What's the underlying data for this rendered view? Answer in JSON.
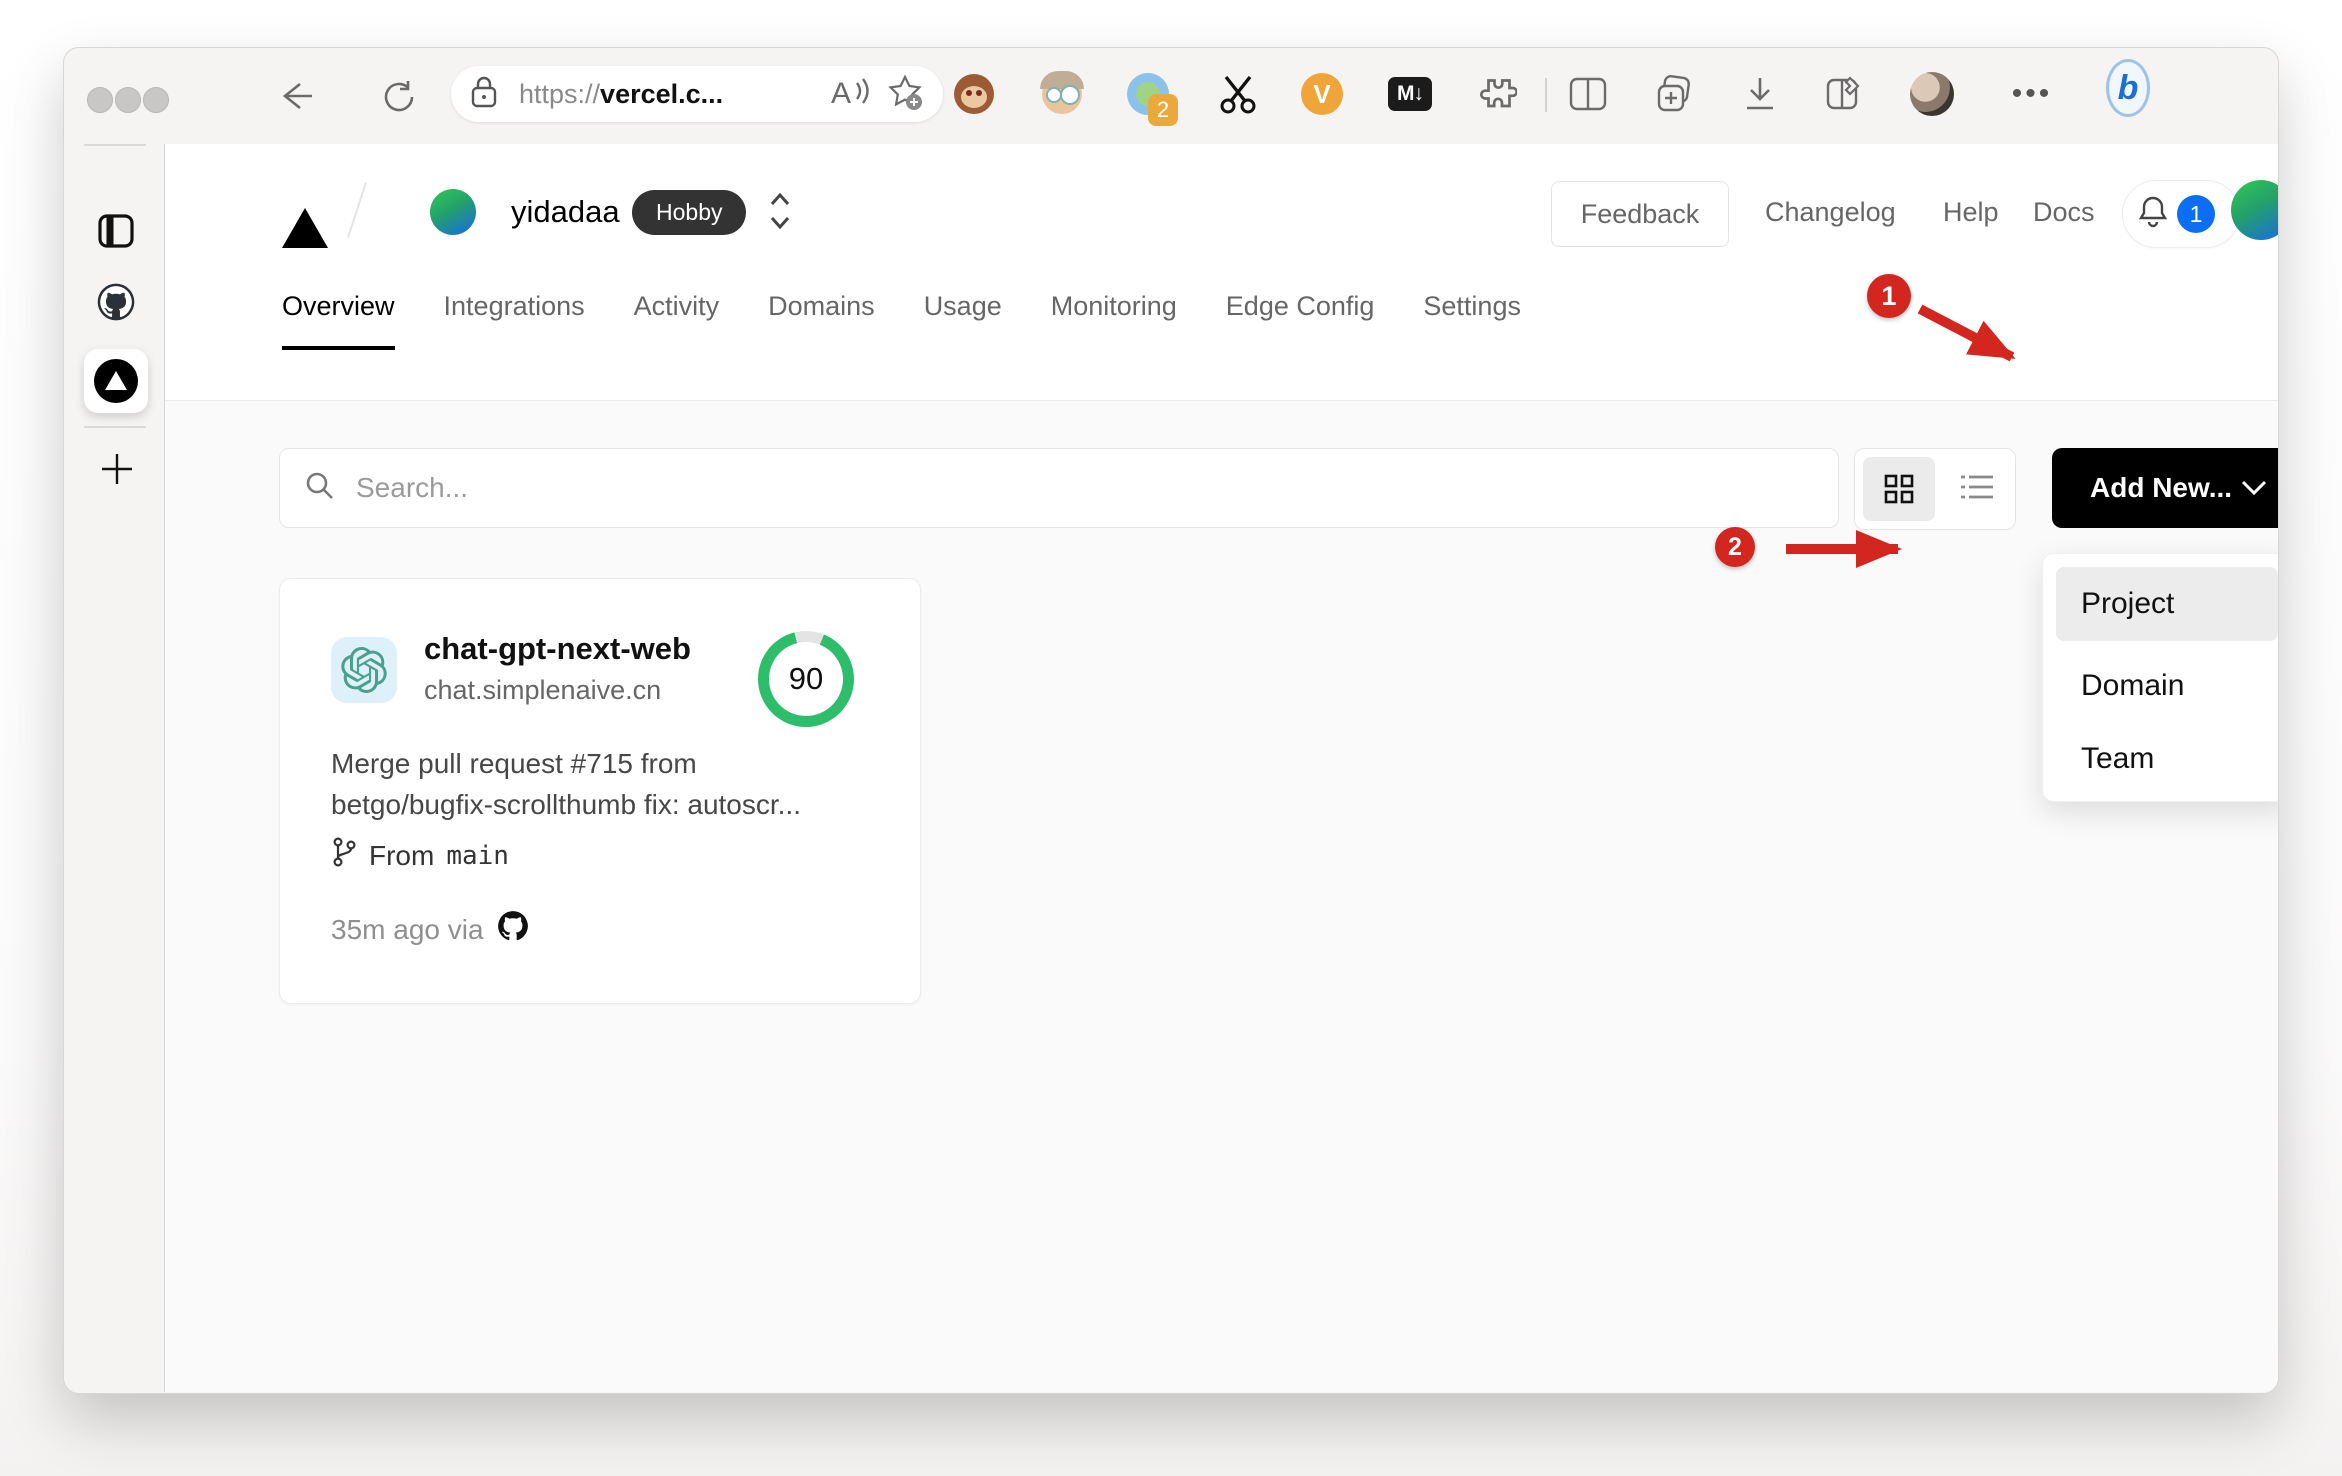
{
  "browser": {
    "url_scheme": "https://",
    "url_host": "vercel.c...",
    "extension_badge": "2",
    "v_ext_label": "V",
    "markdown_ext_label": "M↓",
    "bing_label": "b"
  },
  "vercel": {
    "team_name": "yidadaa",
    "plan_badge": "Hobby",
    "nav": {
      "feedback": "Feedback",
      "changelog": "Changelog",
      "help": "Help",
      "docs": "Docs"
    },
    "notification_count": "1",
    "tabs": [
      {
        "label": "Overview",
        "active": true
      },
      {
        "label": "Integrations",
        "active": false
      },
      {
        "label": "Activity",
        "active": false
      },
      {
        "label": "Domains",
        "active": false
      },
      {
        "label": "Usage",
        "active": false
      },
      {
        "label": "Monitoring",
        "active": false
      },
      {
        "label": "Edge Config",
        "active": false
      },
      {
        "label": "Settings",
        "active": false
      }
    ],
    "search_placeholder": "Search...",
    "add_new_label": "Add New...",
    "project_card": {
      "name": "chat-gpt-next-web",
      "domain": "chat.simplenaive.cn",
      "score": "90",
      "commit_line1": "Merge pull request #715 from",
      "commit_line2": "betgo/bugfix-scrollthumb fix: autoscr...",
      "branch_prefix": "From",
      "branch_name": "main",
      "deploy_meta": "35m ago via"
    },
    "add_new_menu": {
      "items": [
        {
          "label": "Project",
          "selected": true
        },
        {
          "label": "Domain",
          "selected": false
        },
        {
          "label": "Team",
          "selected": false
        }
      ]
    }
  },
  "annotations": {
    "step1": "1",
    "step2": "2"
  },
  "colors": {
    "annotation_red": "#d3261f",
    "score_ring_green": "#2ebd6b",
    "notification_blue": "#0b6ef3",
    "brand_black": "#000000",
    "openai_teal": "#4aa08c",
    "content_background": "#fafafa"
  }
}
